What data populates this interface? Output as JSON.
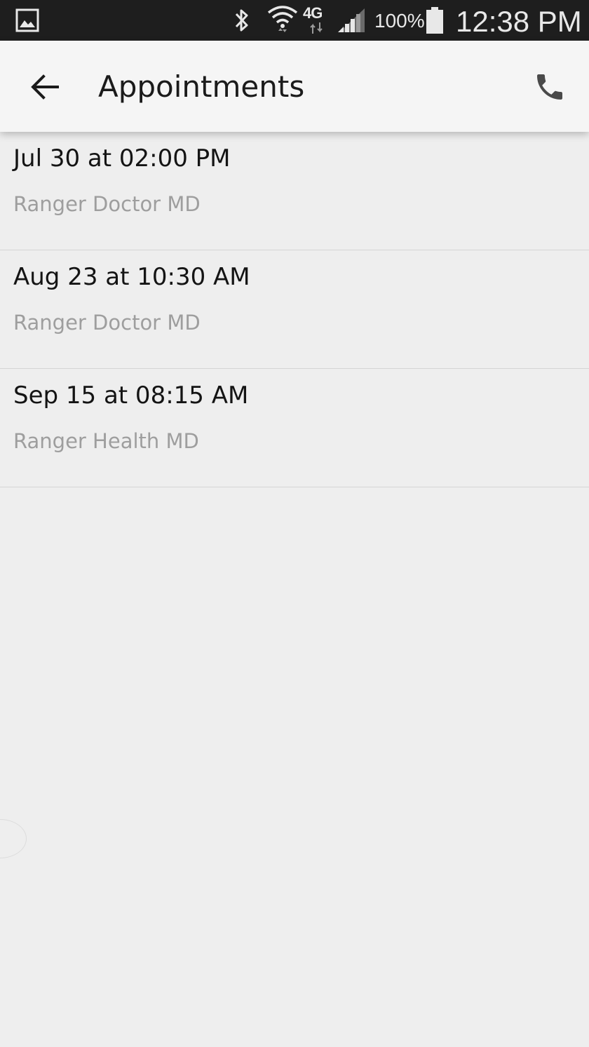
{
  "status_bar": {
    "network_label": "4G",
    "battery_percent": "100%",
    "time": "12:38 PM",
    "icons": [
      "gallery-notification-icon",
      "bluetooth-icon",
      "wifi-icon",
      "signal-icon",
      "battery-icon"
    ]
  },
  "app_bar": {
    "title": "Appointments",
    "back_icon": "arrow-back-icon",
    "call_icon": "phone-icon"
  },
  "appointments": [
    {
      "date": "Jul 30 at 02:00 PM",
      "provider": "Ranger Doctor MD"
    },
    {
      "date": "Aug 23 at 10:30 AM",
      "provider": "Ranger Doctor MD"
    },
    {
      "date": "Sep 15 at 08:15 AM",
      "provider": "Ranger Health MD"
    }
  ],
  "colors": {
    "status_bar_bg": "#1e1e1e",
    "app_bar_bg": "#f5f5f5",
    "page_bg": "#eeeeee",
    "primary_text": "#141414",
    "secondary_text": "#9e9e9e",
    "icon": "#4a4a4a"
  }
}
